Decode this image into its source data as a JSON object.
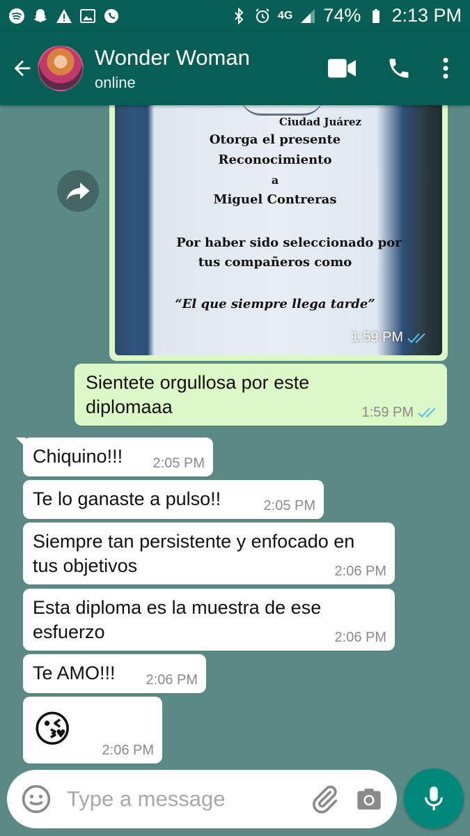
{
  "status_bar": {
    "battery": "74%",
    "time": "2:13 PM",
    "network": "4G",
    "icons": [
      "spotify-icon",
      "snapchat-icon",
      "warning-icon",
      "image-icon",
      "whatsapp-icon",
      "bluetooth-icon",
      "alarm-icon",
      "signal-icon",
      "battery-icon"
    ]
  },
  "header": {
    "contact_name": "Wonder Woman",
    "status": "online",
    "icons": [
      "back-arrow-icon",
      "video-call-icon",
      "phone-icon",
      "more-options-icon"
    ]
  },
  "image_message": {
    "diploma_lines": [
      "Ciudad Juárez",
      "Otorga el presente",
      "Reconocimiento",
      "a",
      "Miguel Contreras",
      "Por haber sido seleccionado por",
      "tus compañeros como",
      "“El que siempre llega tarde”"
    ],
    "time": "1:59 PM",
    "read": true
  },
  "messages": [
    {
      "direction": "out",
      "text": "Sientete orgullosa por este diplomaaa",
      "time": "1:59 PM",
      "read": true
    },
    {
      "direction": "in",
      "text": "Chiquino!!!",
      "time": "2:05 PM"
    },
    {
      "direction": "in",
      "text": "Te lo ganaste a pulso!!",
      "time": "2:05 PM"
    },
    {
      "direction": "in",
      "text": "Siempre tan persistente y enfocado en tus objetivos",
      "time": "2:06 PM"
    },
    {
      "direction": "in",
      "text": "Esta diploma es la muestra de ese esfuerzo",
      "time": "2:06 PM"
    },
    {
      "direction": "in",
      "text": "Te AMO!!!",
      "time": "2:06 PM"
    },
    {
      "direction": "in",
      "text": "😘",
      "time": "2:06 PM"
    }
  ],
  "composer": {
    "placeholder": "Type a message"
  },
  "colors": {
    "header": "#075e54",
    "chat_bg": "#5b8a86",
    "outgoing": "#dcf8c6",
    "incoming": "#ffffff",
    "read_ticks": "#4fc3f7",
    "mic_button": "#00897b"
  }
}
